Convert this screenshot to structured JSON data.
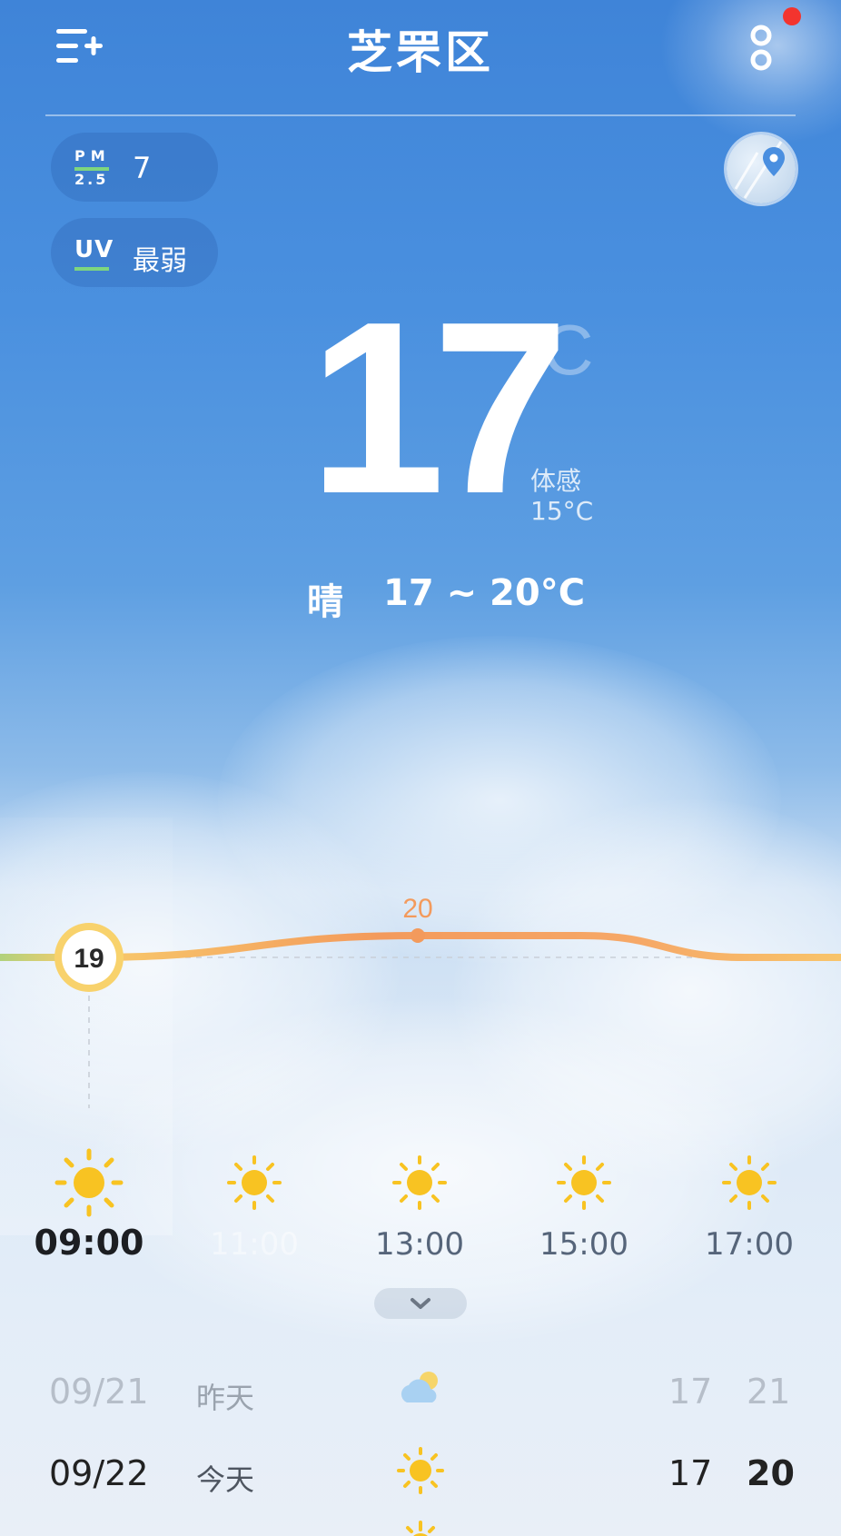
{
  "header": {
    "title": "芝罘区",
    "menu_icon": "list-add-icon",
    "more_icon": "more-vertical-icon"
  },
  "air": {
    "pm_top": "PM",
    "pm_bottom": "2.5",
    "pm_value": "7",
    "uv_label": "UV",
    "uv_value": "最弱"
  },
  "current": {
    "temp": "17",
    "unit": "°C",
    "feels_label": "体感",
    "feels_value": "15°C",
    "condition": "晴",
    "range": "17 ~ 20°C"
  },
  "hourly": {
    "points": [
      19,
      19,
      20,
      20,
      19,
      19
    ],
    "current_label": "19",
    "max_label": "20",
    "hours": [
      {
        "time": "09:00",
        "icon": "sun-icon"
      },
      {
        "time": "11:00",
        "icon": "sun-icon"
      },
      {
        "time": "13:00",
        "icon": "sun-icon"
      },
      {
        "time": "15:00",
        "icon": "sun-icon"
      },
      {
        "time": "17:00",
        "icon": "sun-icon"
      }
    ]
  },
  "daily": [
    {
      "date": "09/21",
      "name": "昨天",
      "icon": "partly-cloudy-icon",
      "lo": "17",
      "hi": "21"
    },
    {
      "date": "09/22",
      "name": "今天",
      "icon": "sun-icon",
      "lo": "17",
      "hi": "20"
    }
  ],
  "colors": {
    "sky_top": "#3f84d8",
    "curve_warm": "#f6b86a",
    "curve_peak": "#f39a5c",
    "sun": "#f8c322",
    "alert_dot": "#f3342e"
  }
}
